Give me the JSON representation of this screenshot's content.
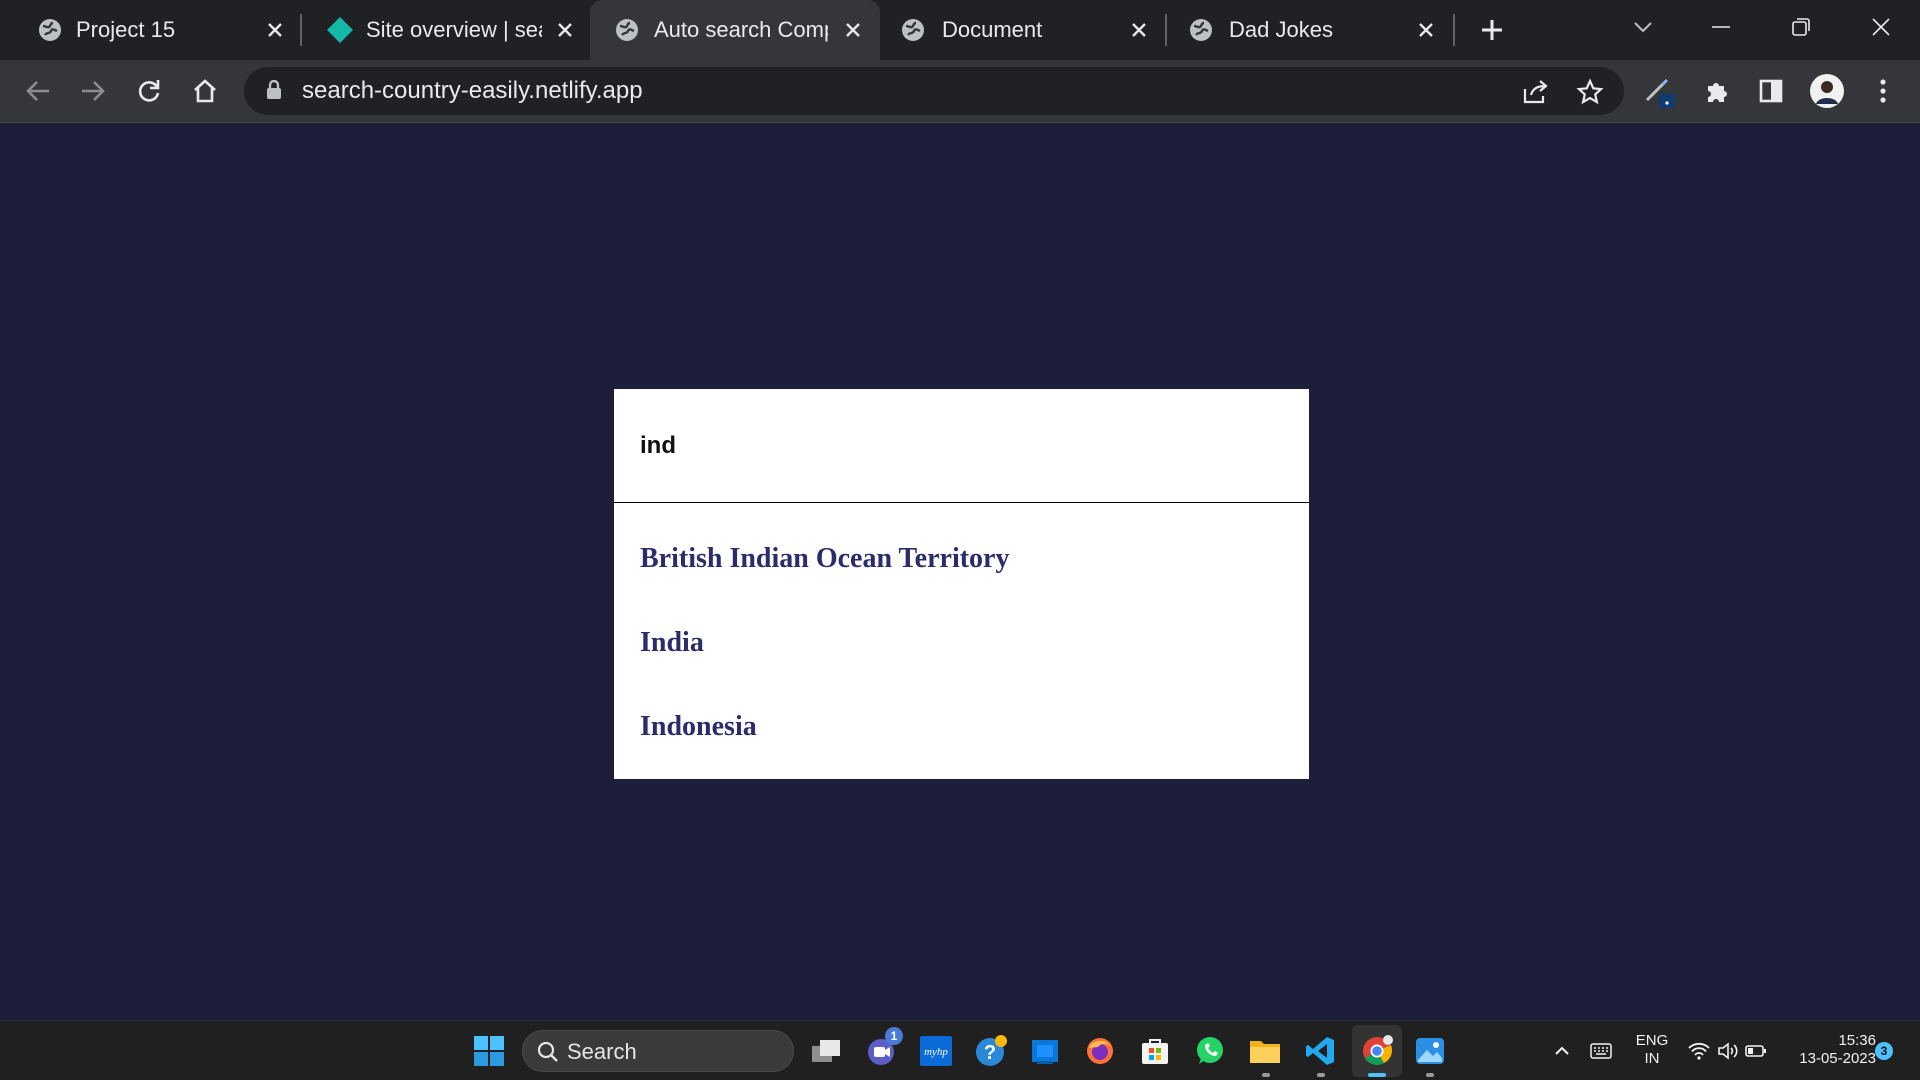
{
  "browser": {
    "tabs": [
      {
        "title": "Project 15",
        "favicon": "globe-icon"
      },
      {
        "title": "Site overview | search-country-easily",
        "favicon": "netlify-diamond-icon"
      },
      {
        "title": "Auto search Complete",
        "favicon": "globe-icon",
        "active": true
      },
      {
        "title": "Document",
        "favicon": "globe-icon"
      },
      {
        "title": "Dad Jokes",
        "favicon": "globe-icon"
      }
    ],
    "address": "search-country-easily.netlify.app"
  },
  "page": {
    "search": {
      "value": "ind"
    },
    "results": [
      "British Indian Ocean Territory",
      "India",
      "Indonesia"
    ],
    "colors": {
      "background": "#1d1e3a",
      "card": "#ffffff",
      "result_text": "#2b2c6b"
    }
  },
  "taskbar": {
    "search_label": "Search",
    "teams_badge": "1",
    "language": {
      "line1": "ENG",
      "line2": "IN"
    },
    "clock": {
      "time": "15:36",
      "date": "13-05-2023"
    },
    "notification_count": "3"
  }
}
